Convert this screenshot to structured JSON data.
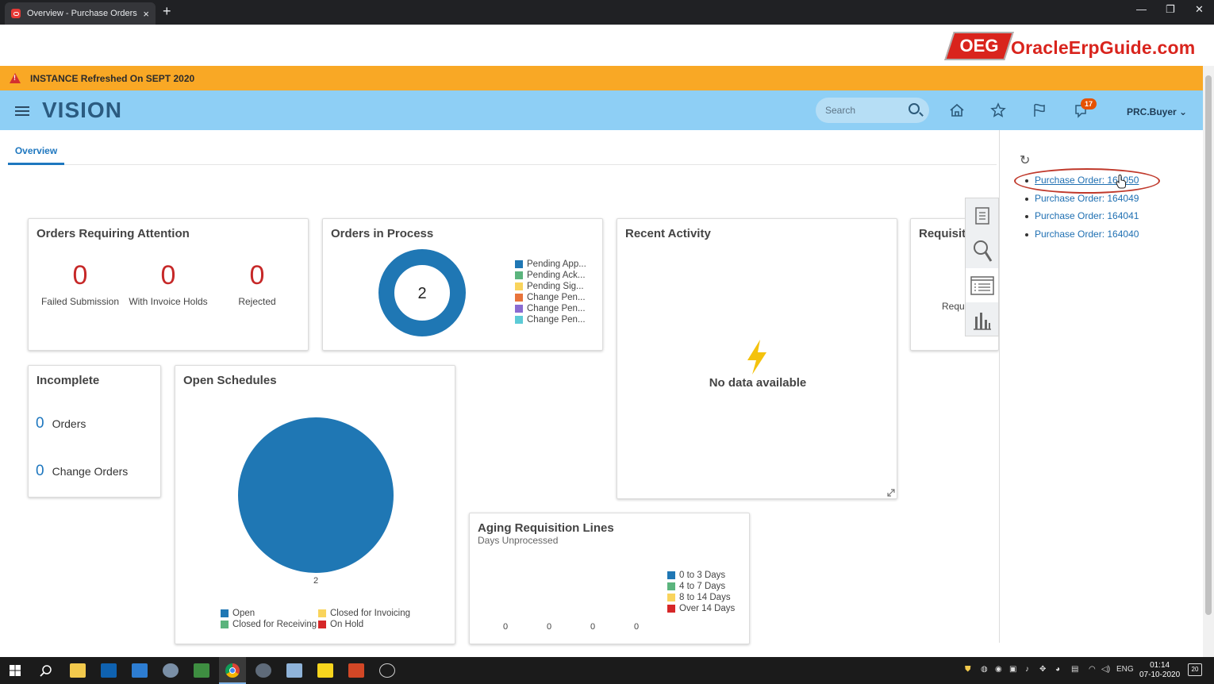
{
  "browser": {
    "tab_title": "Overview - Purchase Orders - Or",
    "tab_close": "×",
    "new_tab": "+",
    "minimize": "—",
    "restore": "❐",
    "close": "✕"
  },
  "logo": {
    "badge": "OEG",
    "text": "OracleErpGuide.com"
  },
  "banner": {
    "text": "INSTANCE Refreshed On SEPT 2020"
  },
  "header": {
    "brand": "VISION",
    "search_placeholder": "Search",
    "notifications_count": "17",
    "user": "PRC.Buyer"
  },
  "tabs": [
    {
      "label": "Overview"
    }
  ],
  "cards": {
    "attention": {
      "title": "Orders Requiring Attention",
      "metrics": [
        {
          "value": "0",
          "label": "Failed Submission"
        },
        {
          "value": "0",
          "label": "With Invoice Holds"
        },
        {
          "value": "0",
          "label": "Rejected"
        }
      ]
    },
    "in_process": {
      "title": "Orders in Process",
      "center_value": "2",
      "legend": [
        {
          "label": "Pending App...",
          "color": "#1f77b4"
        },
        {
          "label": "Pending Ack...",
          "color": "#5bb47d"
        },
        {
          "label": "Pending Sig...",
          "color": "#f9d45c"
        },
        {
          "label": "Change Pen...",
          "color": "#e8743b"
        },
        {
          "label": "Change Pen...",
          "color": "#8a6bd1"
        },
        {
          "label": "Change Pen...",
          "color": "#5ccbd6"
        }
      ]
    },
    "recent": {
      "title": "Recent Activity",
      "empty_text": "No data available"
    },
    "requisitions": {
      "title": "Requisit",
      "partial_label": "Requ"
    },
    "incomplete": {
      "title": "Incomplete",
      "rows": [
        {
          "value": "0",
          "label": "Orders"
        },
        {
          "value": "0",
          "label": "Change Orders"
        }
      ]
    },
    "open_schedules": {
      "title": "Open Schedules",
      "legend": [
        {
          "label": "Open",
          "color": "#1f77b4"
        },
        {
          "label": "Closed for Invoicing",
          "color": "#f9d45c"
        },
        {
          "label": "Closed for Receiving",
          "color": "#5bb47d"
        },
        {
          "label": "On Hold",
          "color": "#d62728"
        }
      ]
    },
    "aging": {
      "title": "Aging Requisition Lines",
      "subtitle": "Days Unprocessed",
      "legend": [
        {
          "label": "0 to 3 Days",
          "color": "#1f77b4"
        },
        {
          "label": "4 to 7 Days",
          "color": "#5bb47d"
        },
        {
          "label": "8 to 14 Days",
          "color": "#f9d45c"
        },
        {
          "label": "Over 14 Days",
          "color": "#d62728"
        }
      ]
    }
  },
  "chart_data": [
    {
      "type": "pie",
      "categories": [
        "Pending App...",
        "Pending Ack...",
        "Pending Sig...",
        "Change Pen...",
        "Change Pen...",
        "Change Pen..."
      ],
      "values": [
        2,
        0,
        0,
        0,
        0,
        0
      ],
      "title": "Orders in Process",
      "center_label": "2",
      "legend": "right"
    },
    {
      "type": "pie",
      "categories": [
        "Open",
        "Closed for Invoicing",
        "Closed for Receiving",
        "On Hold"
      ],
      "values": [
        2,
        0,
        0,
        0
      ],
      "data_labels": [
        "2"
      ],
      "title": "Open Schedules",
      "legend": "bottom"
    },
    {
      "type": "bar",
      "categories": [
        "0 to 3 Days",
        "4 to 7 Days",
        "8 to 14 Days",
        "Over 14 Days"
      ],
      "values": [
        0,
        0,
        0,
        0
      ],
      "data_labels": [
        "0",
        "0",
        "0",
        "0"
      ],
      "title": "Aging Requisition Lines",
      "subtitle": "Days Unprocessed",
      "legend": "right"
    }
  ],
  "right_panel": {
    "recent_items": [
      {
        "label": "Purchase Order: 164050"
      },
      {
        "label": "Purchase Order: 164049"
      },
      {
        "label": "Purchase Order: 164041"
      },
      {
        "label": "Purchase Order: 164040"
      }
    ]
  },
  "taskbar": {
    "lang": "ENG",
    "time": "01:14",
    "date": "07-10-2020",
    "notif": "20"
  }
}
